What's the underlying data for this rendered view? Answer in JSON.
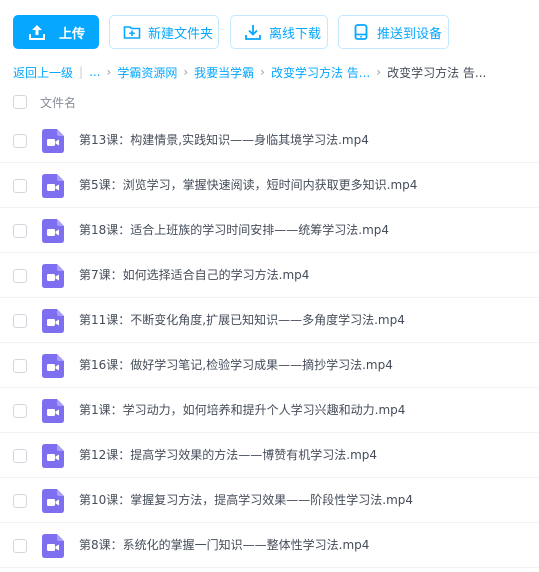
{
  "toolbar": {
    "upload_label": "上传",
    "new_folder_label": "新建文件夹",
    "offline_download_label": "离线下载",
    "push_to_device_label": "推送到设备"
  },
  "breadcrumb": {
    "back": "返回上一级",
    "ellipsis": "...",
    "items": [
      "学霸资源网",
      "我要当学霸",
      "改变学习方法 告..."
    ],
    "current": "改变学习方法 告..."
  },
  "list": {
    "header_label": "文件名",
    "files": [
      "第13课：构建情景,实践知识——身临其境学习法.mp4",
      "第5课：浏览学习，掌握快速阅读，短时间内获取更多知识.mp4",
      "第18课：适合上班族的学习时间安排——统筹学习法.mp4",
      "第7课：如何选择适合自己的学习方法.mp4",
      "第11课：不断变化角度,扩展已知知识——多角度学习法.mp4",
      "第16课：做好学习笔记,检验学习成果——摘抄学习法.mp4",
      "第1课：学习动力，如何培养和提升个人学习兴趣和动力.mp4",
      "第12课：提高学习效果的方法——博赞有机学习法.mp4",
      "第10课：掌握复习方法，提高学习效果——阶段性学习法.mp4",
      "第8课：系统化的掌握一门知识——整体性学习法.mp4"
    ]
  },
  "colors": {
    "accent": "#06a7ff",
    "video_icon": "#7e6ff0"
  },
  "icons": {
    "upload": "upload-icon",
    "new_folder": "folder-plus-icon",
    "offline_download": "download-icon",
    "push_to_device": "device-icon",
    "file": "video-file-icon"
  }
}
